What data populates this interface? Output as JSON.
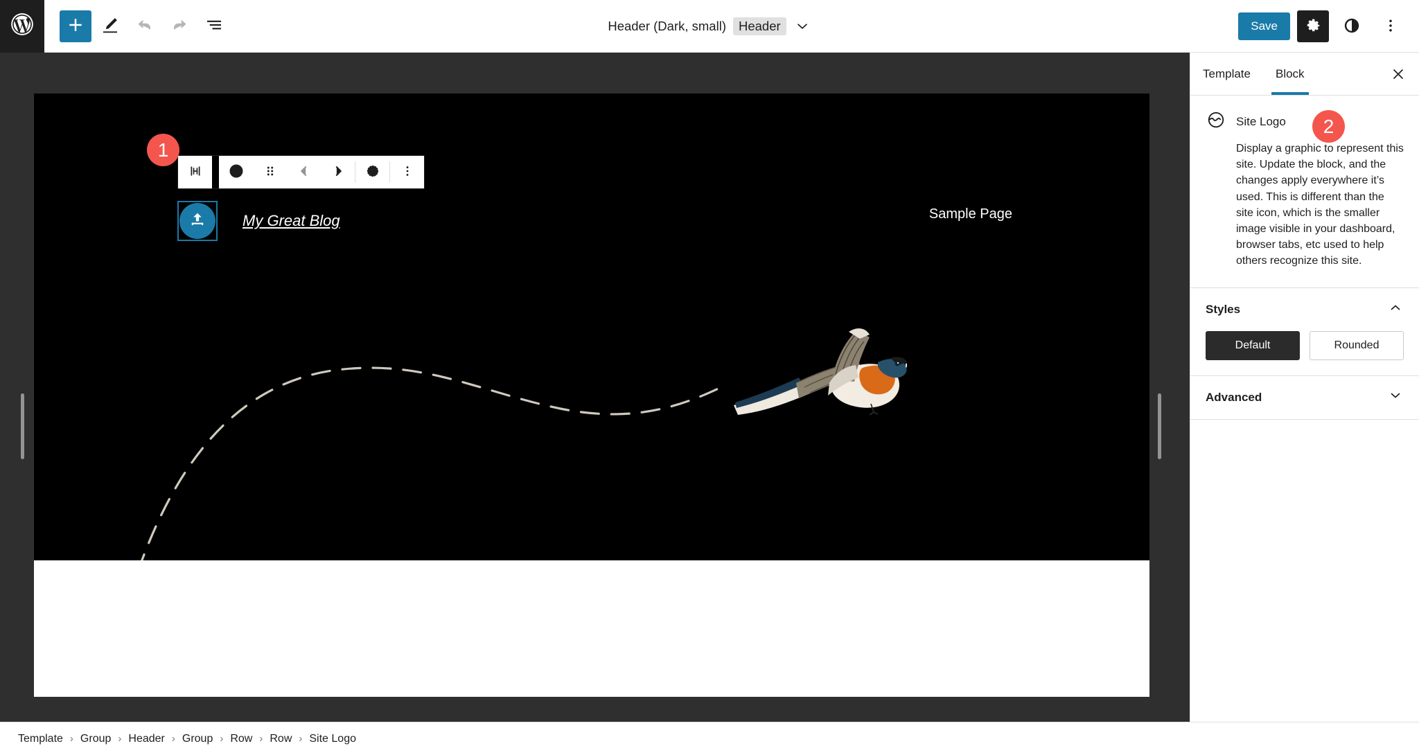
{
  "topbar": {
    "logo_icon": "wordpress-logo-icon",
    "add_block_label": "+",
    "add_block_icon": "plus-icon",
    "edit_icon": "pencil-icon",
    "undo_icon": "undo-icon",
    "redo_icon": "redo-icon",
    "list_view_icon": "list-view-icon",
    "document_title": "Header (Dark, small)",
    "document_badge": "Header",
    "chevron_icon": "chevron-down-icon",
    "save_label": "Save",
    "settings_icon": "gear-icon",
    "styles_icon": "contrast-icon",
    "more_icon": "more-vertical-icon"
  },
  "block_toolbar": {
    "parent_select_icon": "select-parent-icon",
    "block_type_icon": "site-logo-icon",
    "drag_icon": "drag-handle-icon",
    "move_up_icon": "chevron-left-icon",
    "move_down_icon": "chevron-right-icon",
    "shape_icon": "dotted-circle-icon",
    "options_icon": "more-vertical-icon"
  },
  "canvas": {
    "site_logo_placeholder_icon": "upload-icon",
    "site_title": "My Great Blog",
    "nav_link": "Sample Page",
    "bird_alt": "flying-swallow-illustration",
    "flight_path_alt": "dashed-flight-path"
  },
  "badges": {
    "step_one": "1",
    "step_two": "2"
  },
  "sidebar": {
    "tabs": [
      {
        "label": "Template",
        "active": false
      },
      {
        "label": "Block",
        "active": true
      }
    ],
    "close_icon": "close-icon",
    "block": {
      "icon": "site-logo-icon",
      "name": "Site Logo",
      "description": "Display a graphic to represent this site. Update the block, and the changes apply everywhere it’s used. This is different than the site icon, which is the smaller image visible in your dashboard, browser tabs, etc used to help others recognize this site."
    },
    "panels": [
      {
        "title": "Styles",
        "expanded": true,
        "chevron_icon": "chevron-up-icon",
        "options": [
          {
            "label": "Default",
            "selected": true
          },
          {
            "label": "Rounded",
            "selected": false
          }
        ]
      },
      {
        "title": "Advanced",
        "expanded": false,
        "chevron_icon": "chevron-down-icon"
      }
    ]
  },
  "breadcrumb": [
    "Template",
    "Group",
    "Header",
    "Group",
    "Row",
    "Row",
    "Site Logo"
  ],
  "breadcrumb_separator": "›",
  "colors": {
    "accent": "#1a7aa8",
    "badge": "#f4564e",
    "editor_bg": "#2f2f2f",
    "canvas_header_bg": "#000000",
    "canvas_body_bg": "#ffffff",
    "chrome_bg": "#ffffff"
  }
}
